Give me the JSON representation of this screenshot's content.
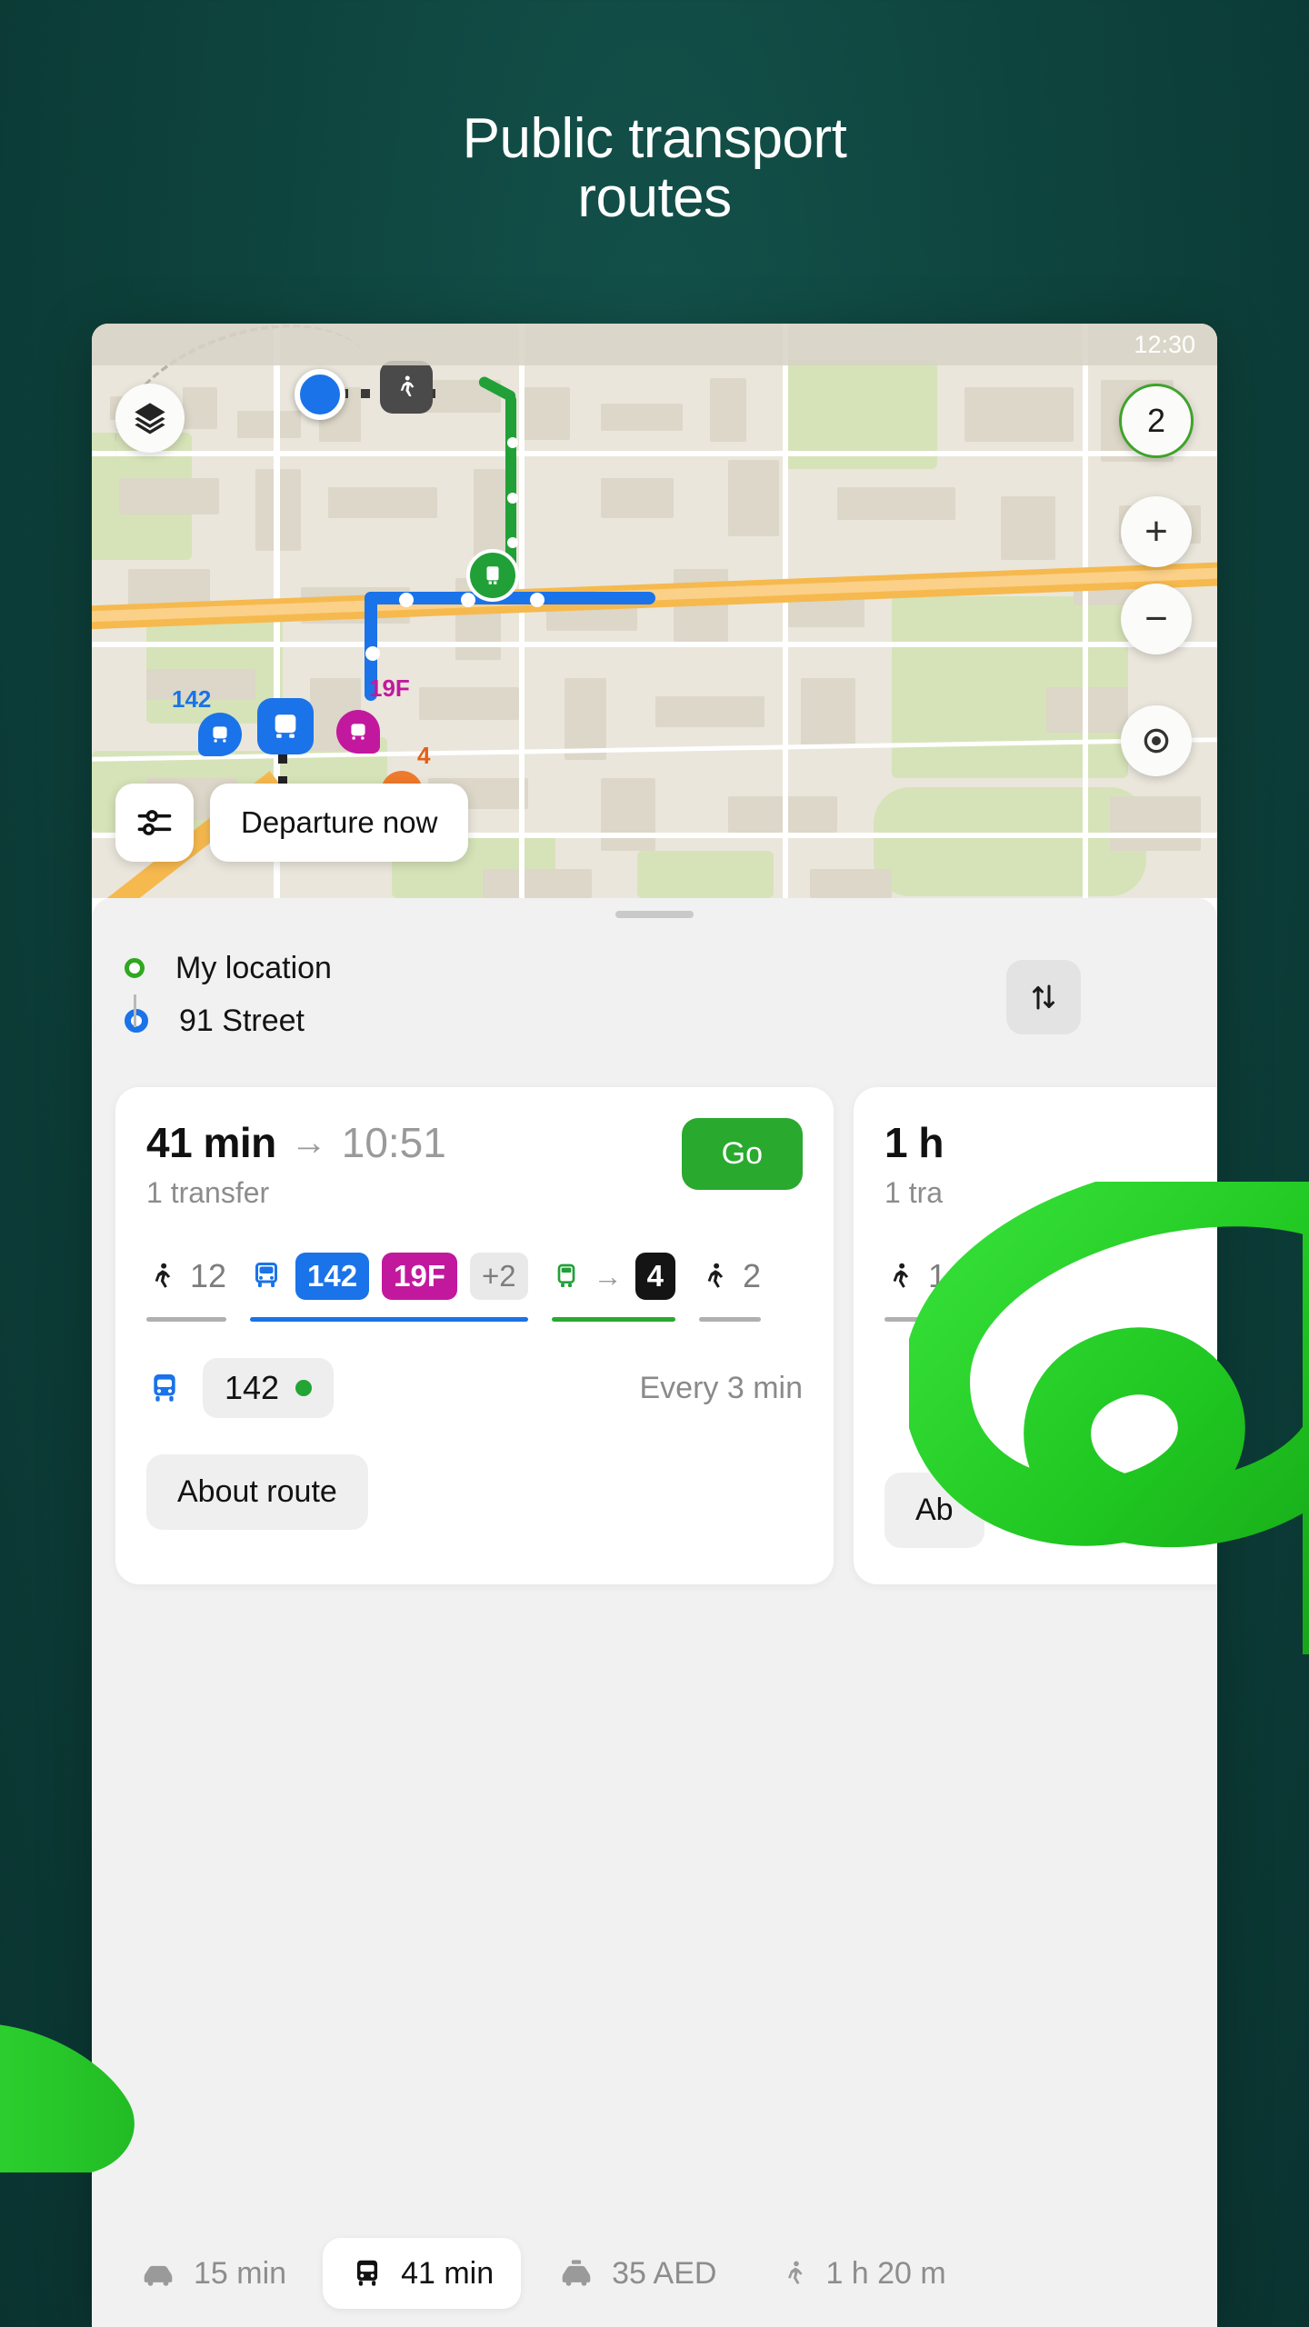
{
  "headline": {
    "line1": "Public transport",
    "line2": "routes"
  },
  "map": {
    "status_time": "12:30",
    "zoom_count": "2",
    "zoom_in_label": "+",
    "zoom_out_label": "−",
    "layers_icon": "layers-icon",
    "filter_icon": "filters-icon",
    "departure_button": "Departure now",
    "labels": [
      {
        "text": "142",
        "color": "#1a73e8"
      },
      {
        "text": "19F",
        "color": "#c2189e"
      },
      {
        "text": "4",
        "color": "#e2601a"
      }
    ]
  },
  "sheet": {
    "origin": "My location",
    "destination": "91 Street",
    "swap_icon": "swap-vertical-icon"
  },
  "routes": [
    {
      "duration": "41 min",
      "arrow": "→",
      "eta": "10:51",
      "transfers": "1 transfer",
      "go_label": "Go",
      "legs": [
        {
          "type": "walk",
          "value": "12",
          "bar_color": "#b0b0b0"
        },
        {
          "type": "bus",
          "chips": [
            {
              "label": "142",
              "color": "#1a73e8"
            },
            {
              "label": "19F",
              "color": "#c2189e"
            },
            {
              "label": "+2",
              "color": "#e9e9e9"
            }
          ],
          "bar_color": "#1a73e8"
        },
        {
          "type": "tram",
          "chips": [
            {
              "label": "4",
              "color": "#141414"
            }
          ],
          "arrow": "→",
          "bar_color": "#2aa92f"
        },
        {
          "type": "walk",
          "value": "2",
          "bar_color": "#b0b0b0"
        }
      ],
      "route_number": "142",
      "frequency": "Every 3 min",
      "about_label": "About route"
    },
    {
      "duration": "1 h",
      "transfers": "1 tra",
      "leg_walk": "1",
      "about_label": "Ab"
    }
  ],
  "tabs": [
    {
      "icon": "car-icon",
      "label": "15 min",
      "active": false
    },
    {
      "icon": "bus-icon",
      "label": "41 min",
      "active": true
    },
    {
      "icon": "taxi-icon",
      "label": "35 AED",
      "active": false
    },
    {
      "icon": "walk-icon",
      "label": "1 h 20 m",
      "active": false
    }
  ],
  "colors": {
    "background": "#0e433d",
    "accent_green": "#2aa92f",
    "bus_blue": "#1a73e8",
    "magenta": "#c2189e"
  }
}
